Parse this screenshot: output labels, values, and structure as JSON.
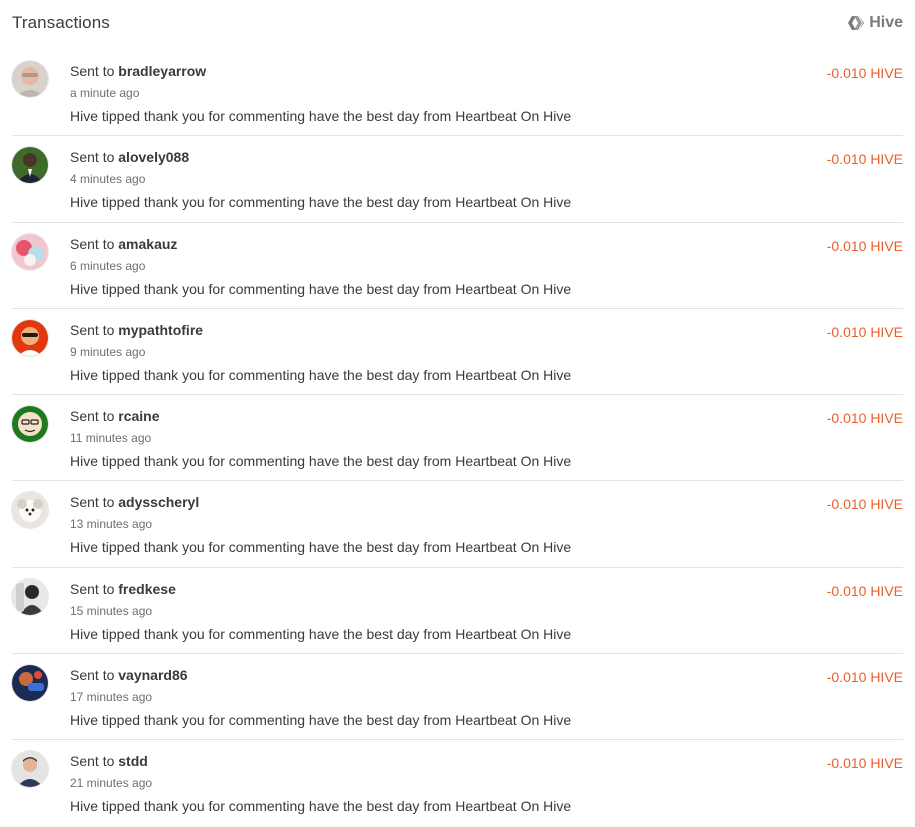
{
  "header": {
    "title": "Transactions",
    "brand_label": "Hive",
    "brand_icon": "hive-logo-icon"
  },
  "colors": {
    "amount": "#e8612a",
    "text": "#3a3a3a",
    "muted": "#6f6f6f",
    "divider": "#e3e3e3"
  },
  "transactions": [
    {
      "prefix": "Sent to",
      "user": "bradleyarrow",
      "time": "a minute ago",
      "memo": "Hive tipped thank you for commenting have the best day from Heartbeat On Hive",
      "amount": "-0.010 HIVE",
      "avatar": "avatar-bradleyarrow"
    },
    {
      "prefix": "Sent to",
      "user": "alovely088",
      "time": "4 minutes ago",
      "memo": "Hive tipped thank you for commenting have the best day from Heartbeat On Hive",
      "amount": "-0.010 HIVE",
      "avatar": "avatar-alovely088"
    },
    {
      "prefix": "Sent to",
      "user": "amakauz",
      "time": "6 minutes ago",
      "memo": "Hive tipped thank you for commenting have the best day from Heartbeat On Hive",
      "amount": "-0.010 HIVE",
      "avatar": "avatar-amakauz"
    },
    {
      "prefix": "Sent to",
      "user": "mypathtofire",
      "time": "9 minutes ago",
      "memo": "Hive tipped thank you for commenting have the best day from Heartbeat On Hive",
      "amount": "-0.010 HIVE",
      "avatar": "avatar-mypathtofire"
    },
    {
      "prefix": "Sent to",
      "user": "rcaine",
      "time": "11 minutes ago",
      "memo": "Hive tipped thank you for commenting have the best day from Heartbeat On Hive",
      "amount": "-0.010 HIVE",
      "avatar": "avatar-rcaine"
    },
    {
      "prefix": "Sent to",
      "user": "adysscheryl",
      "time": "13 minutes ago",
      "memo": "Hive tipped thank you for commenting have the best day from Heartbeat On Hive",
      "amount": "-0.010 HIVE",
      "avatar": "avatar-adysscheryl"
    },
    {
      "prefix": "Sent to",
      "user": "fredkese",
      "time": "15 minutes ago",
      "memo": "Hive tipped thank you for commenting have the best day from Heartbeat On Hive",
      "amount": "-0.010 HIVE",
      "avatar": "avatar-fredkese"
    },
    {
      "prefix": "Sent to",
      "user": "vaynard86",
      "time": "17 minutes ago",
      "memo": "Hive tipped thank you for commenting have the best day from Heartbeat On Hive",
      "amount": "-0.010 HIVE",
      "avatar": "avatar-vaynard86"
    },
    {
      "prefix": "Sent to",
      "user": "stdd",
      "time": "21 minutes ago",
      "memo": "Hive tipped thank you for commenting have the best day from Heartbeat On Hive",
      "amount": "-0.010 HIVE",
      "avatar": "avatar-stdd"
    }
  ]
}
